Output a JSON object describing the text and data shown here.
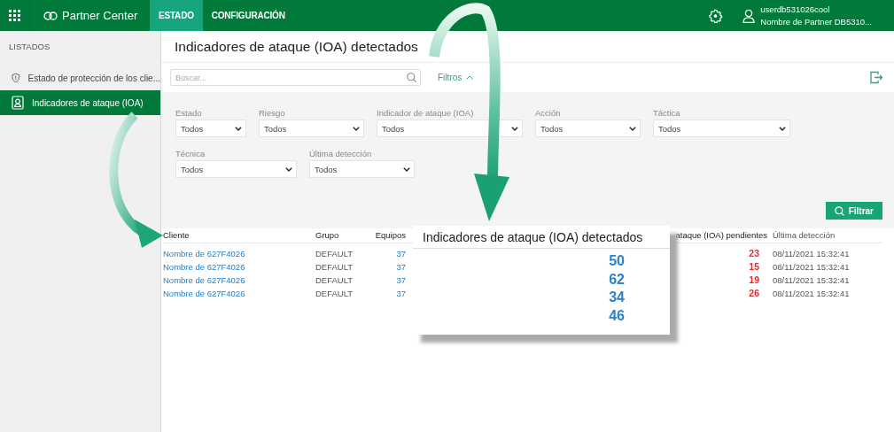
{
  "header": {
    "app_name": "Partner Center",
    "tabs": [
      {
        "label": "ESTADO",
        "selected": true
      },
      {
        "label": "CONFIGURACIÓN",
        "selected": false
      }
    ],
    "user": {
      "name": "userdb531026cool",
      "partner": "Nombre de Partner DB5310..."
    }
  },
  "sidebar": {
    "heading": "LISTADOS",
    "items": [
      {
        "label": "Estado de protección de los clie...",
        "kind": "shield",
        "selected": false
      },
      {
        "label": "Indicadores de ataque (IOA)",
        "kind": "profile",
        "selected": true
      }
    ]
  },
  "main": {
    "title": "Indicadores de ataque (IOA) detectados",
    "search": {
      "placeholder": "Buscar..."
    },
    "filters_toggle": "Filtros",
    "filter_rows": [
      [
        {
          "label": "Estado",
          "value": "Todos"
        },
        {
          "label": "Riesgo",
          "value": "Todos"
        },
        {
          "label": "Indicador de ataque (IOA)",
          "value": "Todos"
        },
        {
          "label": "Acción",
          "value": "Todos"
        },
        {
          "label": "Táctica",
          "value": "Todos"
        }
      ],
      [
        {
          "label": "Técnica",
          "value": "Todos"
        },
        {
          "label": "Última detección",
          "value": "Todos"
        }
      ]
    ],
    "filter_button": "Filtrar",
    "table": {
      "columns": [
        "Cliente",
        "Grupo",
        "Equipos",
        "ataque (IOA) pendientes",
        "Última detección"
      ],
      "rows": [
        [
          "Nombre de 627F4026",
          "DEFAULT",
          "37",
          "23",
          "08/11/2021 15:32:41"
        ],
        [
          "Nombre de 627F4026",
          "DEFAULT",
          "37",
          "15",
          "08/11/2021 15:32:41"
        ],
        [
          "Nombre de 627F4026",
          "DEFAULT",
          "37",
          "19",
          "08/11/2021 15:32:41"
        ],
        [
          "Nombre de 627F4026",
          "DEFAULT",
          "37",
          "26",
          "08/11/2021 15:32:41"
        ]
      ]
    }
  },
  "callout": {
    "title": "Indicadores de ataque (IOA) detectados",
    "values": [
      "50",
      "62",
      "34",
      "46"
    ]
  }
}
